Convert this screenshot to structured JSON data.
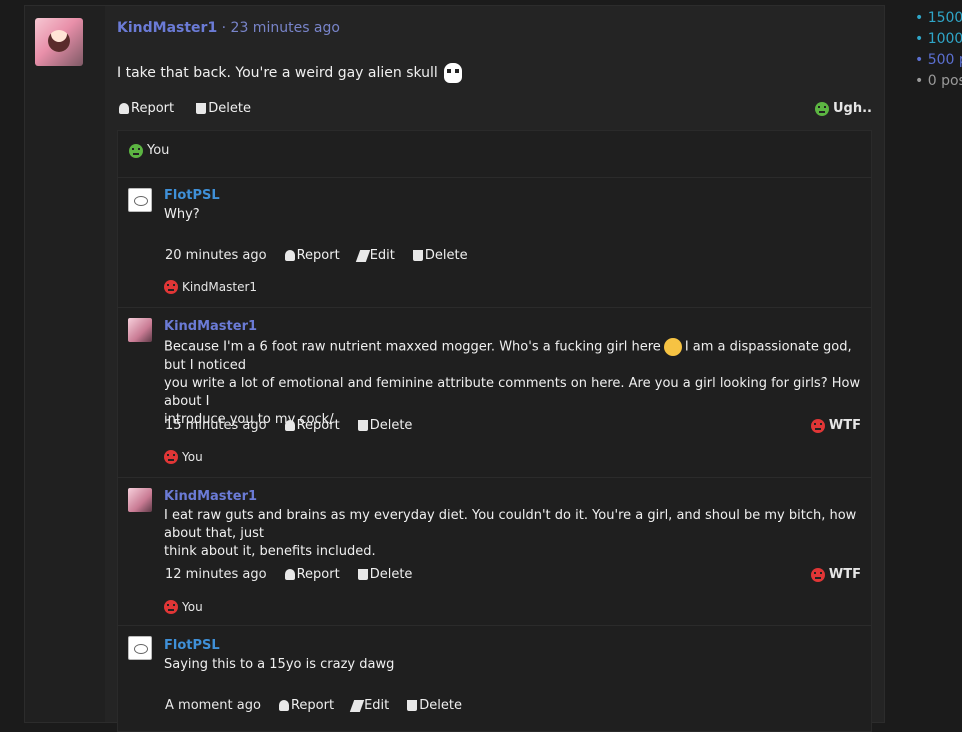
{
  "post": {
    "author": "KindMaster1",
    "separator": "·",
    "time": "23 minutes ago",
    "text": "I take that back. You're a weird gay alien skull",
    "emoji": "skull",
    "actions": {
      "report": "Report",
      "delete": "Delete"
    },
    "reaction": "Ugh..",
    "reacted_by": "You"
  },
  "replies": [
    {
      "author": "FlotPSL",
      "text": "Why?",
      "time": "20 minutes ago",
      "actions": {
        "report": "Report",
        "edit": "Edit",
        "delete": "Delete"
      },
      "reaction": "",
      "reacted_by": "KindMaster1"
    },
    {
      "author": "KindMaster1",
      "text_line1a": "Because I'm a 6 foot raw nutrient maxxed mogger. Who's a fucking girl here",
      "text_line1b": "I am a dispassionate god, but I noticed",
      "text_line2": "you write a lot of emotional and feminine attribute comments on here. Are you a girl looking for girls? How about I",
      "text_line3": "introduce you to my cock/",
      "time": "15 minutes ago",
      "actions": {
        "report": "Report",
        "delete": "Delete"
      },
      "reaction": "WTF",
      "reacted_by": "You"
    },
    {
      "author": "KindMaster1",
      "text_line1": "I eat raw guts and brains as my everyday diet. You couldn't do it. You're a girl, and shoul be my bitch, how about that, just",
      "text_line2": "think about it, benefits included.",
      "time": "12 minutes ago",
      "actions": {
        "report": "Report",
        "delete": "Delete"
      },
      "reaction": "WTF",
      "reacted_by": "You"
    },
    {
      "author": "FlotPSL",
      "text": "Saying this to a 15yo is crazy dawg",
      "time": "A moment ago",
      "actions": {
        "report": "Report",
        "edit": "Edit",
        "delete": "Delete"
      }
    }
  ],
  "sidebar": {
    "items": [
      "• 1500",
      "• 1000",
      "• 500 p",
      "• 0 pos"
    ],
    "colors": [
      "#2fa6c8",
      "#2fa6c8",
      "#5b6fd0",
      "#9a9a9a"
    ]
  }
}
